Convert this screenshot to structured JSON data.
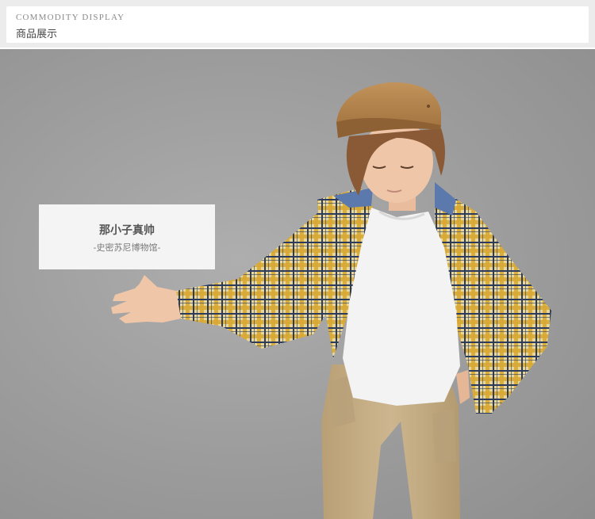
{
  "header": {
    "title_en": "COMMODITY DISPLAY",
    "title_cn": "商品展示"
  },
  "caption": {
    "title": "那小子真帅",
    "subtitle": "-史密苏尼博物馆-"
  },
  "colors": {
    "header_band": "#ececec",
    "photo_background": "#9c9c9c",
    "caption_background": "#f4f4f4",
    "hat": "#b5834a",
    "hair": "#8a5a36",
    "skin": "#f0c6a8",
    "shirt_plaid_yellow": "#e0b64a",
    "shirt_plaid_navy": "#2c3b5e",
    "tshirt": "#f3f3f3",
    "pants": "#c7b08a"
  },
  "photo": {
    "subject": "boy in plaid shirt and flat cap"
  }
}
